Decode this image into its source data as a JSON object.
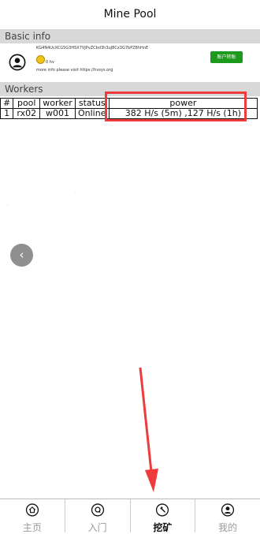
{
  "header": {
    "title": "Mine Pool"
  },
  "basic_info": {
    "section_title": "Basic info",
    "account_line": "KG4N4UcXCG5G3HSX7VJPvZCbd3h3uJ8Cx3G7bPZ8hHnE",
    "coin_label": "0 hv",
    "note": "more info please visit https://hvsys.org",
    "transfer_button": "账户转账"
  },
  "workers": {
    "section_title": "Workers",
    "columns": [
      "#",
      "pool",
      "worker",
      "status",
      "power"
    ],
    "rows": [
      {
        "index": "1",
        "pool": "rx02",
        "worker": "w001",
        "status": "Online",
        "power": "382 H/s (5m) ,127 H/s (1h)"
      }
    ]
  },
  "back_button": {
    "glyph": "‹"
  },
  "accent_colors": {
    "annotation_red": "#ef3b3b",
    "button_green": "#1b9a1b"
  },
  "tabs": [
    {
      "label": "主页",
      "icon": "home-icon",
      "active": false
    },
    {
      "label": "入门",
      "icon": "q-icon",
      "active": false
    },
    {
      "label": "挖矿",
      "icon": "hammer-icon",
      "active": true
    },
    {
      "label": "我的",
      "icon": "person-icon",
      "active": false
    }
  ]
}
